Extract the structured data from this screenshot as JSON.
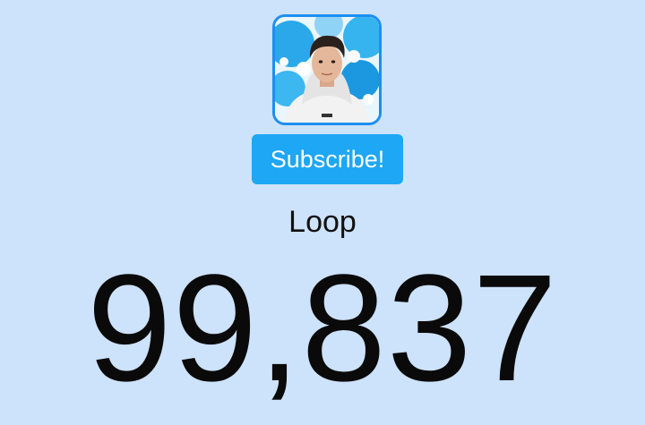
{
  "channel": {
    "name": "Loop",
    "avatar_icon": "channel-avatar-photo"
  },
  "subscribe_button": {
    "label": "Subscribe!",
    "color": "#1ea7f4"
  },
  "counter": {
    "value": "99,837"
  },
  "colors": {
    "background": "#cde2fb",
    "avatar_border": "#1e8ff0",
    "text": "#0a0a0a"
  }
}
